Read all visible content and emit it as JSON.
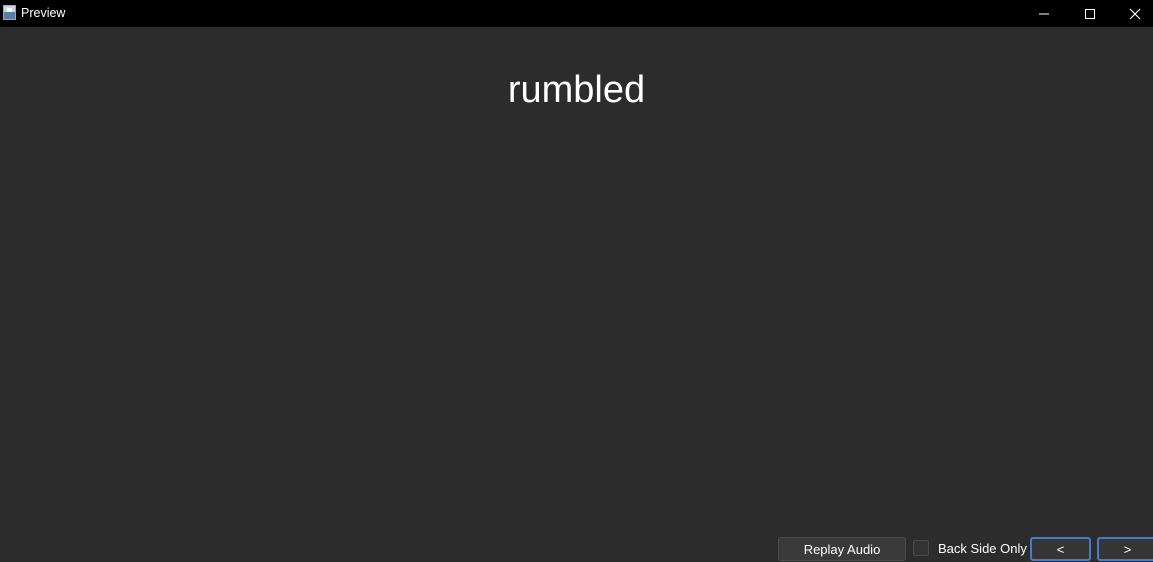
{
  "window": {
    "title": "Preview",
    "icon": "app-icon",
    "controls": {
      "minimize_icon": "minimize-icon",
      "maximize_icon": "maximize-icon",
      "close_icon": "close-icon"
    }
  },
  "card": {
    "word": "rumbled"
  },
  "controls": {
    "replay_label": "Replay Audio",
    "back_side_only_label": "Back Side Only",
    "back_side_only_checked": false,
    "prev_label": "<",
    "next_label": ">"
  },
  "colors": {
    "background": "#2c2c2c",
    "titlebar": "#000000",
    "text": "#ffffff",
    "nav_border": "#4a79c6"
  }
}
